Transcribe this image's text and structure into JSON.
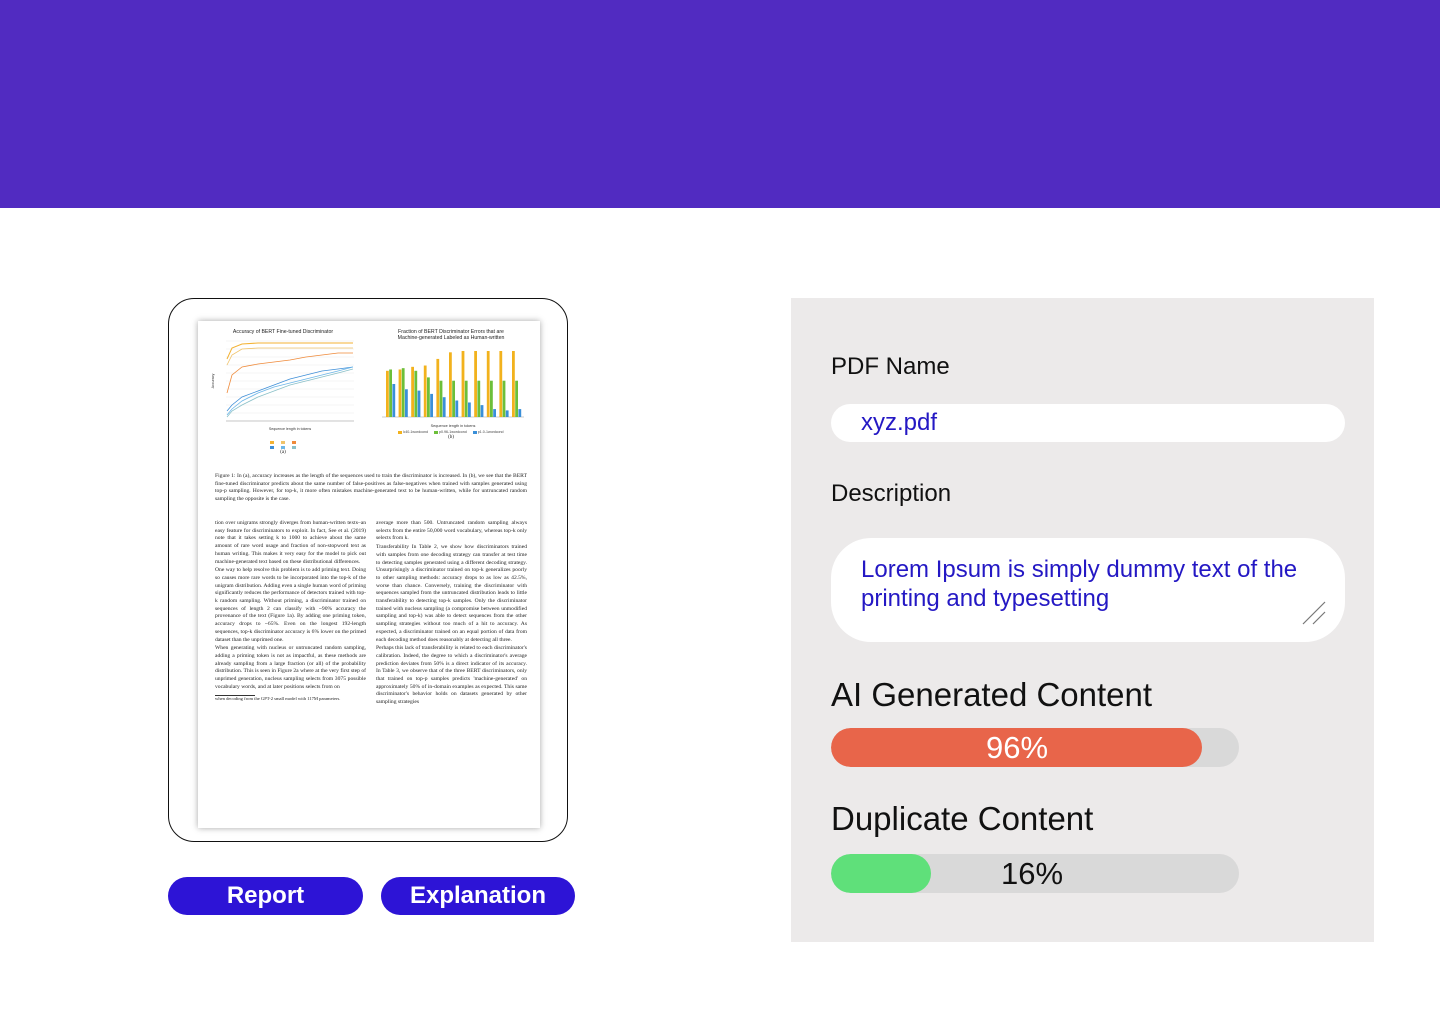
{
  "preview": {
    "fig_a": {
      "title": "Accuracy of BERT Fine-tuned Discriminator",
      "xlabel": "Sequence length in tokens",
      "ylabel": "Accuracy",
      "caption": "(a)"
    },
    "fig_b": {
      "title_line1": "Fraction of BERT Discriminator Errors that are",
      "title_line2": "Machine-generated Labeled as Human-written",
      "xlabel": "Sequence length in tokens",
      "caption": "(b)",
      "legend": [
        "k40-1wordcond",
        "p0.96-1wordcond",
        "p1.0-1wordcond"
      ]
    },
    "figure_caption": "Figure 1: In (a), accuracy increases as the length of the sequences used to train the discriminator is increased. In (b), we see that the BERT fine-tuned discriminator predicts about the same number of false-positives as false-negatives when trained with samples generated using top-p sampling. However, for top-k, it more often mistakes machine-generated text to be human-written, while for untruncated random sampling the opposite is the case.",
    "col_left": [
      "tion over unigrams strongly diverges from human-written texts–an easy feature for discriminators to exploit. In fact, See et al. (2019) note that it takes setting k to 1000 to achieve about the same amount of rare word usage and fraction of non-stopword text as human writing. This makes it very easy for the model to pick out machine-generated text based on these distributional differences.",
      "One way to help resolve this problem is to add priming text. Doing so causes more rare words to be incorporated into the top-k of the unigram distribution. Adding even a single human word of priming significantly reduces the performance of detectors trained with top-k random sampling. Without priming, a discriminator trained on sequences of length 2 can classify with ~90% accuracy the provenance of the text (Figure 1a). By adding one priming token, accuracy drops to ~65%. Even on the longest 192-length sequences, top-k discriminator accuracy is 6% lower on the primed dataset than the unprimed one.",
      "When generating with nucleus or untruncated random sampling, adding a priming token is not as impactful, as these methods are already sampling from a large fraction (or all) of the probability distribution. This is seen in Figure 2a where at the very first step of unprimed generation, nucleus sampling selects from 3075 possible vocabulary words, and at later positions selects from on"
    ],
    "footnote": "when decoding from the GPT-2 small model with 117M parameters.",
    "col_right": [
      "average more than 500. Untruncated random sampling always selects from the entire 50,000 word vocabulary, whereas top-k only selects from k.",
      "Transferability In Table 2, we show how discriminators trained with samples from one decoding strategy can transfer at test time to detecting samples generated using a different decoding strategy. Unsurprisingly a discriminator trained on top-k generalizes poorly to other sampling methods: accuracy drops to as low as 42.5%, worse than chance. Conversely, training the discriminator with sequences sampled from the untruncated distribution leads to little transferability to detecting top-k samples. Only the discriminator trained with nucleus sampling (a compromise between unmodified sampling and top-k) was able to detect sequences from the other sampling strategies without too much of a hit to accuracy. As expected, a discriminator trained on an equal portion of data from each decoding method does reasonably at detecting all three.",
      "Perhaps this lack of transferability is related to each discriminator's calibration. Indeed, the degree to which a discriminator's average prediction deviates from 50% is a direct indicator of its accuracy. In Table 3, we observe that of the three BERT discriminators, only that trained on top-p samples predicts 'machine-generated' on approximately 50% of in-domain examples as expected. This same discriminator's behavior holds on datasets generated by other sampling strategies"
    ]
  },
  "buttons": {
    "report": "Report",
    "explanation": "Explanation"
  },
  "panel": {
    "pdf_name_label": "PDF Name",
    "pdf_name_value": "xyz.pdf",
    "description_label": "Description",
    "description_value": "Lorem Ipsum is simply dummy text of the printing and typesetting",
    "ai_title": "AI Generated Content",
    "ai_percent_text": "96%",
    "ai_percent": 96,
    "dup_title": "Duplicate Content",
    "dup_percent_text": "16%",
    "dup_percent": 16
  },
  "colors": {
    "header": "#512bc1",
    "button": "#2d14d6",
    "ai_bar": "#e8654a",
    "dup_bar": "#5fe07a",
    "field_text": "#2418c4"
  }
}
